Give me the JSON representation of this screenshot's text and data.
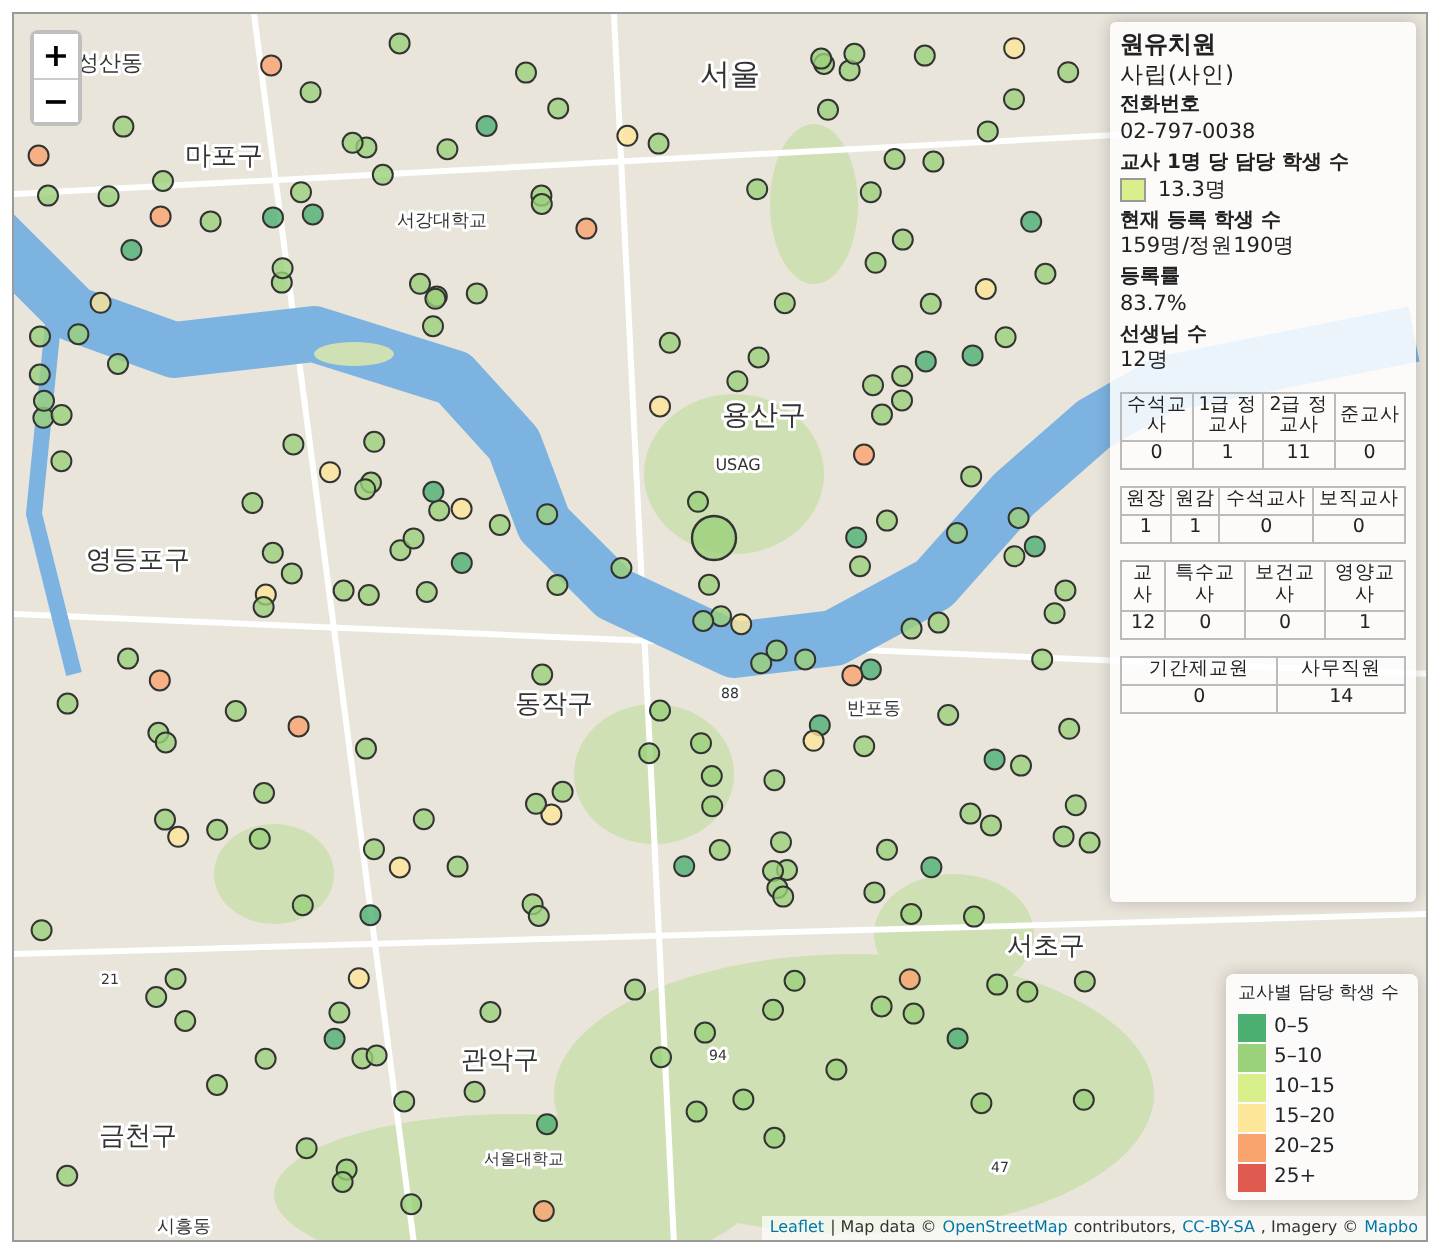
{
  "zoom_controls": [
    "+",
    "−"
  ],
  "map_labels": [
    "성산동",
    "서울",
    "마포구",
    "서강대학교",
    "용산구",
    "USAG",
    "영등포구",
    "동작구",
    "반포동",
    "서초구",
    "관악구",
    "서울대학교",
    "금천구",
    "시흥동",
    "88",
    "94",
    "47",
    "21"
  ],
  "info": {
    "name": "원유치원",
    "type": "사립(사인)",
    "fields": [
      {
        "label": "전화번호",
        "value": "02-797-0038"
      },
      {
        "label": "교사 1명 당 담당 학생 수",
        "value": "13.3명",
        "color": "#d9ef8b"
      },
      {
        "label": "현재 등록 학생 수",
        "value": "159명/정원190명"
      },
      {
        "label": "등록률",
        "value": "83.7%"
      },
      {
        "label": "선생님 수",
        "value": "12명"
      }
    ],
    "tables": [
      {
        "headers": [
          "수석교사",
          "1급 정교사",
          "2급 정교사",
          "준교사"
        ],
        "values": [
          "0",
          "1",
          "11",
          "0"
        ]
      },
      {
        "headers": [
          "원장",
          "원감",
          "수석교사",
          "보직교사"
        ],
        "values": [
          "1",
          "1",
          "0",
          "0"
        ]
      },
      {
        "headers": [
          "교사",
          "특수교사",
          "보건교사",
          "영양교사"
        ],
        "values": [
          "12",
          "0",
          "0",
          "1"
        ]
      },
      {
        "headers": [
          "기간제교원",
          "사무직원"
        ],
        "values": [
          "0",
          "14"
        ]
      }
    ]
  },
  "legend": {
    "title": "교사별 담당 학생 수",
    "items": [
      {
        "label": "0–5",
        "color": "#4caf72"
      },
      {
        "label": "5–10",
        "color": "#9bd17a"
      },
      {
        "label": "10–15",
        "color": "#d9ef8b"
      },
      {
        "label": "15–20",
        "color": "#fde69a"
      },
      {
        "label": "20–25",
        "color": "#f9a36e"
      },
      {
        "label": "25+",
        "color": "#e05a50"
      }
    ]
  },
  "attribution": [
    {
      "kind": "link",
      "text": "Leaflet"
    },
    {
      "kind": "text",
      "text": "| Map data ©"
    },
    {
      "kind": "link",
      "text": "OpenStreetMap"
    },
    {
      "kind": "text",
      "text": "contributors,"
    },
    {
      "kind": "link",
      "text": "CC-BY-SA"
    },
    {
      "kind": "text",
      "text": ", Imagery ©"
    },
    {
      "kind": "link",
      "text": "Mapbo"
    }
  ]
}
